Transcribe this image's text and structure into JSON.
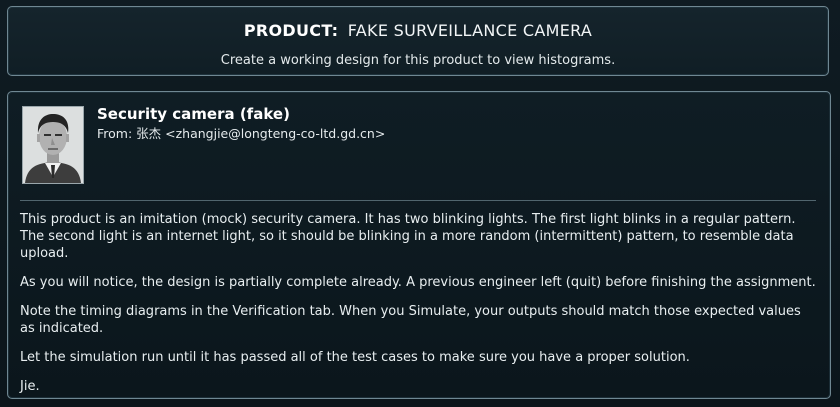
{
  "header": {
    "prefix": "PRODUCT:",
    "product_name": "FAKE SURVEILLANCE CAMERA",
    "subtitle": "Create a working design for this product to view histograms."
  },
  "message": {
    "avatar_icon": "person-portrait",
    "title": "Security camera (fake)",
    "from": "From: 张杰 <zhangjie@longteng-co-ltd.gd.cn>",
    "paragraphs": [
      "This product is an imitation (mock) security camera. It has two blinking lights. The first light blinks in a regular pattern. The second light is an internet light, so it should be blinking in a more random (intermittent) pattern, to resemble data upload.",
      "As you will notice, the design is partially complete already. A previous engineer left (quit) before finishing the assignment.",
      "Note the timing diagrams in the Verification tab. When you Simulate, your outputs should match those expected values as indicated.",
      "Let the simulation run until it has passed all of the test cases to make sure you have a proper solution.",
      "Jie."
    ]
  },
  "colors": {
    "background": "#0c161c",
    "panel_border": "#6f8792",
    "text": "#e8eef0"
  }
}
